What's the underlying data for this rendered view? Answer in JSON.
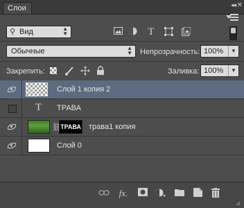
{
  "panel": {
    "tab_label": "Слои",
    "collapse": "◂◂",
    "close": "✕"
  },
  "filter": {
    "kind_label": "Вид",
    "icons": [
      "image-filter-icon",
      "adjustment-filter-icon",
      "type-filter-icon",
      "shape-filter-icon",
      "smart-object-filter-icon"
    ]
  },
  "blend": {
    "mode": "Обычные",
    "opacity_label": "Непрозрачность:",
    "opacity_value": "100%"
  },
  "lock": {
    "label": "Закрепить:",
    "fill_label": "Заливка:",
    "fill_value": "100%"
  },
  "layers": [
    {
      "name": "Слой 1 копия 2",
      "visible": true,
      "selected": true
    },
    {
      "name": "ТРАВА",
      "visible": false,
      "selected": false,
      "type": "text"
    },
    {
      "name": "трава1 копия",
      "visible": true,
      "selected": false,
      "mask_text": "ТРАВА"
    },
    {
      "name": "Слой 0",
      "visible": true,
      "selected": false
    }
  ],
  "bottom_icons": [
    "link-layers-icon",
    "fx-icon",
    "add-mask-icon",
    "adjustment-layer-icon",
    "new-group-icon",
    "new-layer-icon",
    "delete-icon"
  ],
  "bottom_fx": "fx."
}
